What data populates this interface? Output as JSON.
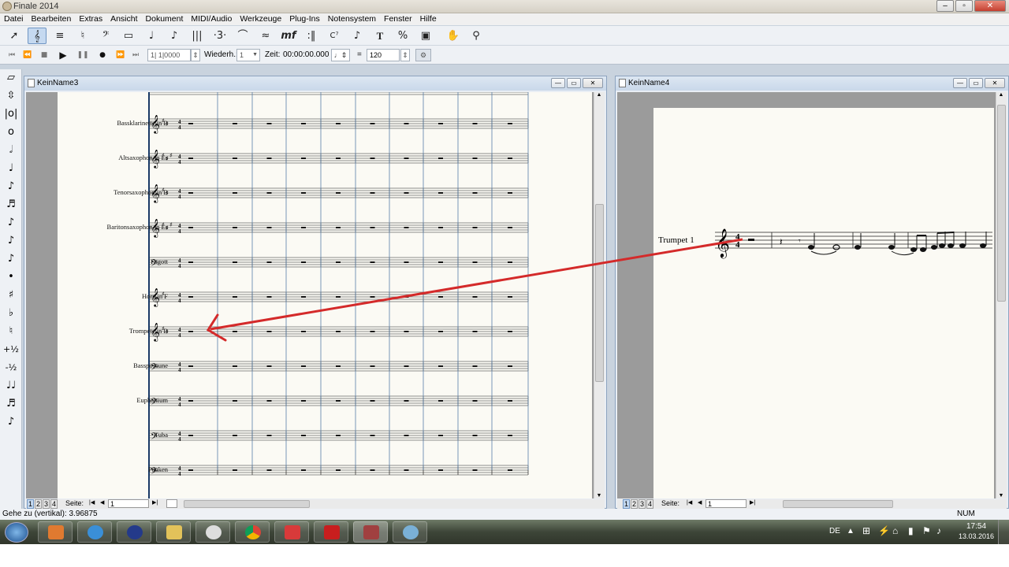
{
  "app": {
    "title": "Finale 2014"
  },
  "menu": [
    "Datei",
    "Bearbeiten",
    "Extras",
    "Ansicht",
    "Dokument",
    "MIDI/Audio",
    "Werkzeuge",
    "Plug-Ins",
    "Notensystem",
    "Fenster",
    "Hilfe"
  ],
  "playback": {
    "position": "1| 1|0000",
    "repeat_label": "Wiederh.:",
    "repeat_value": "1",
    "time_label": "Zeit:",
    "time_value": "00:00:00.000",
    "tempo_eq": "=",
    "tempo": "120"
  },
  "windows": {
    "score": {
      "title": "KeinName3",
      "page_label": "Seite:",
      "page_value": "1",
      "page_tabs": [
        "1",
        "2",
        "3",
        "4"
      ]
    },
    "part": {
      "title": "KeinName4",
      "page_label": "Seite:",
      "page_value": "1",
      "page_tabs": [
        "1",
        "2",
        "3",
        "4"
      ],
      "instrument": "Trumpet 1"
    }
  },
  "instruments": [
    "Bassklarinette in B",
    "Altsaxophon in Es",
    "Tenorsaxophon in B",
    "Baritonsaxophon in Es",
    "Fagott",
    "Horn in F",
    "Trompete in B",
    "Bassposaune",
    "Euphonium",
    "Tuba",
    "Pauken"
  ],
  "status": {
    "text": "Gehe zu (vertikal): 3.96875",
    "num": "NUM"
  },
  "tray": {
    "lang": "DE",
    "time": "17:54",
    "date": "13.03.2016"
  },
  "colors": {
    "arrow": "#d42a2a",
    "barline": "#5a7fa8",
    "accent": "#6f95c3"
  }
}
